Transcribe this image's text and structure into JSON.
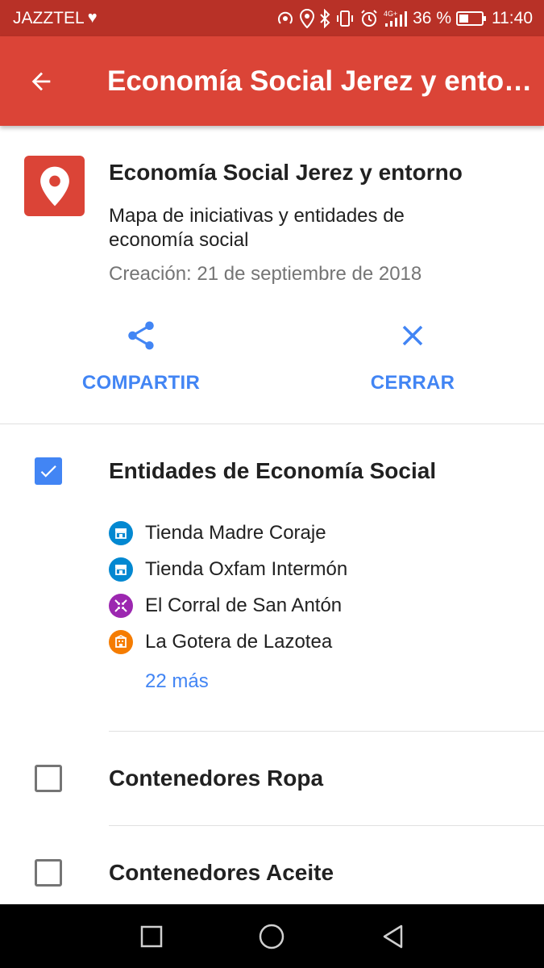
{
  "status_bar": {
    "carrier": "JAZZTEL",
    "battery_percent": "36 %",
    "time": "11:40",
    "network": "4G+",
    "colors": {
      "background": "#b83127"
    }
  },
  "app_bar": {
    "title": "Economía Social Jerez y entorno",
    "back_icon": "arrow-back-icon",
    "color": "#db4437"
  },
  "map": {
    "icon": "map-pin-icon",
    "title": "Economía Social Jerez y entorno",
    "description": "Mapa de iniciativas y entidades de economía social",
    "created": "Creación: 21 de septiembre de 2018"
  },
  "actions": {
    "share": {
      "label": "COMPARTIR",
      "icon": "share-icon"
    },
    "close": {
      "label": "CERRAR",
      "icon": "close-icon"
    },
    "accent": "#4285f4"
  },
  "layers": [
    {
      "name": "Entidades de Economía Social",
      "checked": true,
      "places": [
        {
          "name": "Tienda Madre Coraje",
          "icon": "store-icon",
          "color": "#0288d1"
        },
        {
          "name": "Tienda Oxfam Intermón",
          "icon": "store-icon",
          "color": "#0288d1"
        },
        {
          "name": "El Corral de San Antón",
          "icon": "merge-arrows-icon",
          "color": "#9c27b0"
        },
        {
          "name": "La Gotera de Lazotea",
          "icon": "building-icon",
          "color": "#f57c00"
        }
      ],
      "more": "22 más"
    },
    {
      "name": "Contenedores Ropa",
      "checked": false
    },
    {
      "name": "Contenedores Aceite",
      "checked": false
    }
  ],
  "nav_bar": {
    "buttons": [
      "recent-apps-icon",
      "home-icon",
      "back-triangle-icon"
    ]
  }
}
